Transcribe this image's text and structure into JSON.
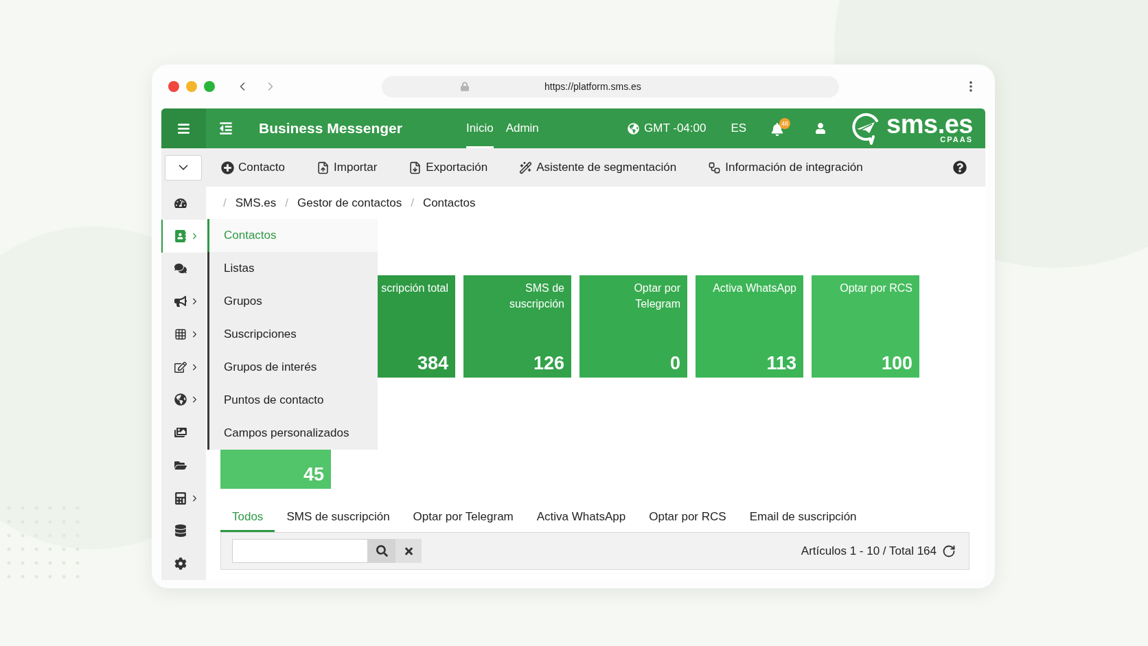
{
  "browser": {
    "url": "https://platform.sms.es"
  },
  "header": {
    "title": "Business Messenger",
    "nav": [
      {
        "label": "Inicio",
        "selected": true
      },
      {
        "label": "Admin",
        "selected": false
      }
    ],
    "timezone": "GMT -04:00",
    "language": "ES",
    "notification_count": "48",
    "logo": {
      "text": "sms.es",
      "tagline": "CPAAS"
    }
  },
  "toolbar": {
    "actions": [
      {
        "kind": "add",
        "label": "Contacto"
      },
      {
        "kind": "import",
        "label": "Importar"
      },
      {
        "kind": "export",
        "label": "Exportación"
      },
      {
        "kind": "wizard",
        "label": "Asistente de segmentación"
      },
      {
        "kind": "integration",
        "label": "Información de integración"
      }
    ]
  },
  "sidebar": {
    "items": [
      {
        "kind": "gauge",
        "selected": false,
        "expandable": false
      },
      {
        "kind": "contacts",
        "selected": true,
        "expandable": true
      },
      {
        "kind": "chat",
        "selected": false,
        "expandable": false
      },
      {
        "kind": "megaphone",
        "selected": false,
        "expandable": true
      },
      {
        "kind": "grid",
        "selected": false,
        "expandable": true
      },
      {
        "kind": "edit",
        "selected": false,
        "expandable": true
      },
      {
        "kind": "globe",
        "selected": false,
        "expandable": true
      },
      {
        "kind": "images",
        "selected": false,
        "expandable": false
      },
      {
        "kind": "folder",
        "selected": false,
        "expandable": false
      },
      {
        "kind": "calculator",
        "selected": false,
        "expandable": true
      },
      {
        "kind": "database",
        "selected": false,
        "expandable": false
      },
      {
        "kind": "settings",
        "selected": false,
        "expandable": false
      }
    ]
  },
  "breadcrumb": [
    {
      "kind": "separator",
      "text": "/"
    },
    {
      "kind": "link",
      "text": "SMS.es"
    },
    {
      "kind": "separator",
      "text": "/"
    },
    {
      "kind": "link",
      "text": "Gestor de contactos"
    },
    {
      "kind": "separator",
      "text": "/"
    },
    {
      "kind": "link",
      "text": "Contactos"
    }
  ],
  "submenu": {
    "items": [
      {
        "label": "Contactos",
        "selected": true
      },
      {
        "label": "Listas",
        "selected": false
      },
      {
        "label": "Grupos",
        "selected": false
      },
      {
        "label": "Suscripciones",
        "selected": false
      },
      {
        "label": "Grupos de interés",
        "selected": false
      },
      {
        "label": "Puntos de contacto",
        "selected": false
      },
      {
        "label": "Campos personalizados",
        "selected": false
      }
    ]
  },
  "stat_cards": [
    {
      "label": "scripción total",
      "value": "384",
      "color": "#2e9a44"
    },
    {
      "label": "SMS de suscripción",
      "value": "126",
      "color": "#33a24a"
    },
    {
      "label": "Optar por Telegram",
      "value": "0",
      "color": "#37ab4f"
    },
    {
      "label": "Activa WhatsApp",
      "value": "113",
      "color": "#3cb556"
    },
    {
      "label": "Optar por RCS",
      "value": "100",
      "color": "#45bd5e"
    }
  ],
  "stat_cards_row_2": [
    {
      "value": "45",
      "color": "#52c46a"
    }
  ],
  "tabs": [
    {
      "label": "Todos",
      "selected": true
    },
    {
      "label": "SMS de suscripción",
      "selected": false
    },
    {
      "label": "Optar por Telegram",
      "selected": false
    },
    {
      "label": "Activa WhatsApp",
      "selected": false
    },
    {
      "label": "Optar por RCS",
      "selected": false
    },
    {
      "label": "Email de suscripción",
      "selected": false
    }
  ],
  "list_toolbar": {
    "pager": "Artículos 1 - 10 / Total 164"
  }
}
